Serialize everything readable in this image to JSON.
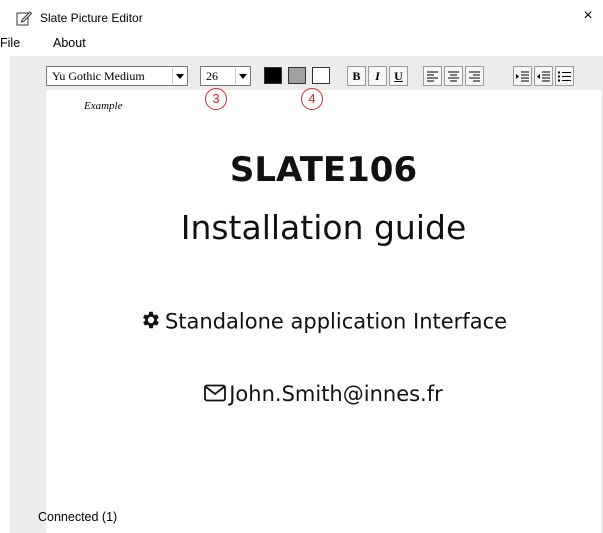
{
  "window": {
    "title": "Slate Picture Editor",
    "close_glyph": "×"
  },
  "menu": {
    "file": "File",
    "about": "About"
  },
  "toolbar": {
    "font_name": "Yu Gothic Medium",
    "font_size": "26",
    "bold": "B",
    "italic": "I",
    "underline": "U",
    "colors": {
      "black": "#000000",
      "gray": "#a0a0a0",
      "white": "#ffffff"
    }
  },
  "callouts": {
    "c3": "3",
    "c4": "4"
  },
  "canvas": {
    "example_label": "Example",
    "title": "SLATE106",
    "subtitle": "Installation guide",
    "line_interface": "Standalone application Interface",
    "line_email": "John.Smith@innes.fr",
    "icons": {
      "gear": "gear-icon",
      "mail": "envelope-icon"
    }
  },
  "status": {
    "text": "Connected (1)"
  }
}
